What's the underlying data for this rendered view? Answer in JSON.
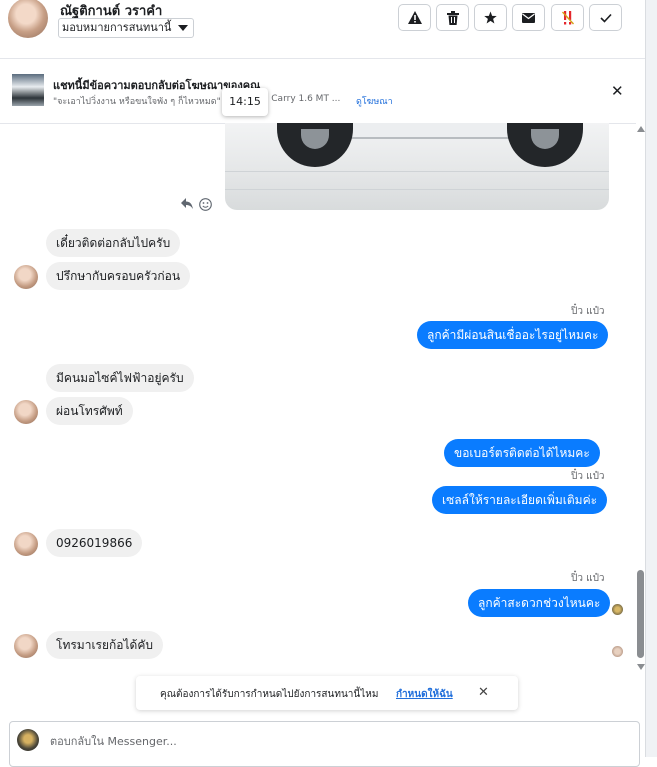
{
  "header": {
    "contact_name": "ณัฐติกานต์ วราคำ",
    "assign_label": "มอบหมายการสนทนานี้"
  },
  "ad_banner": {
    "title": "แชทนี้มีข้อความตอบกลับต่อโฆษณาของคุณ",
    "quote": "\"จะเอาไปวิ่งงาน หรือขนใจพัง ๆ ก็ไหวหมด\"",
    "quote_cont": "uki Carry 1.6 MT ...",
    "link": "ดูโฆษณา"
  },
  "tooltip_time": "14:15",
  "messages": [
    {
      "dir": "in",
      "text": "เดี๋ยวติดต่อกลับไปครับ"
    },
    {
      "dir": "in",
      "text": "ปรึกษากับครอบครัวก่อน"
    },
    {
      "dir": "seen",
      "text": "ปิ๋ว แป๋ว"
    },
    {
      "dir": "out",
      "text": "ลูกค้ามีผ่อนสินเชื่ออะไรอยู่ไหมคะ"
    },
    {
      "dir": "in",
      "text": "มีคนมอไซค์ไฟฟ้าอยู่ครับ"
    },
    {
      "dir": "in",
      "text": "ผ่อนโทรศัพท์"
    },
    {
      "dir": "out",
      "text": "ขอเบอร์ตรติดต่อได้ไหมคะ"
    },
    {
      "dir": "seen",
      "text": "ปิ๋ว แป๋ว"
    },
    {
      "dir": "out",
      "text": "เซลล์ให้รายละเอียดเพิ่มเติมค่ะ"
    },
    {
      "dir": "in",
      "text": "0926019866"
    },
    {
      "dir": "seen",
      "text": "ปิ๋ว แป๋ว"
    },
    {
      "dir": "out",
      "text": "ลูกค้าสะดวกช่วงไหนคะ"
    },
    {
      "dir": "in",
      "text": "โทรมาเรยก้อได้คับ"
    }
  ],
  "notice": {
    "message": "คุณต้องการได้รับการกำหนดไปยังการสนทนานี้ไหม",
    "action": "กำหนดให้ฉัน"
  },
  "composer": {
    "placeholder": "ตอบกลับใน Messenger..."
  }
}
